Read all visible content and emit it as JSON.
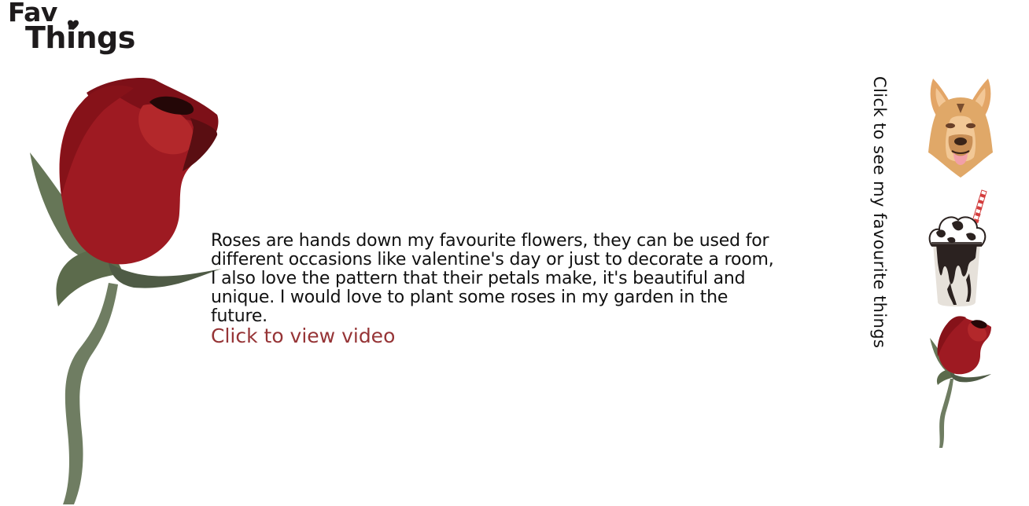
{
  "logo": {
    "line1": "Fav",
    "line2": "Things"
  },
  "main": {
    "description": "Roses are hands down my favourite flowers, they can be used for different occasions like valentine's day or just to decorate a room, I also love the pattern that their petals make, it's beautiful and unique. I would love to plant some roses in my garden in the future.",
    "video_link": "Click to view video"
  },
  "sidebar": {
    "cta": "Click to see my favourite things",
    "thumbnails": [
      {
        "icon": "dog-icon"
      },
      {
        "icon": "milkshake-icon"
      },
      {
        "icon": "rose-icon"
      }
    ]
  },
  "colors": {
    "link": "#963436",
    "rose_red": "#9e1a22",
    "stem_green": "#6f7d62",
    "text": "#111111"
  }
}
